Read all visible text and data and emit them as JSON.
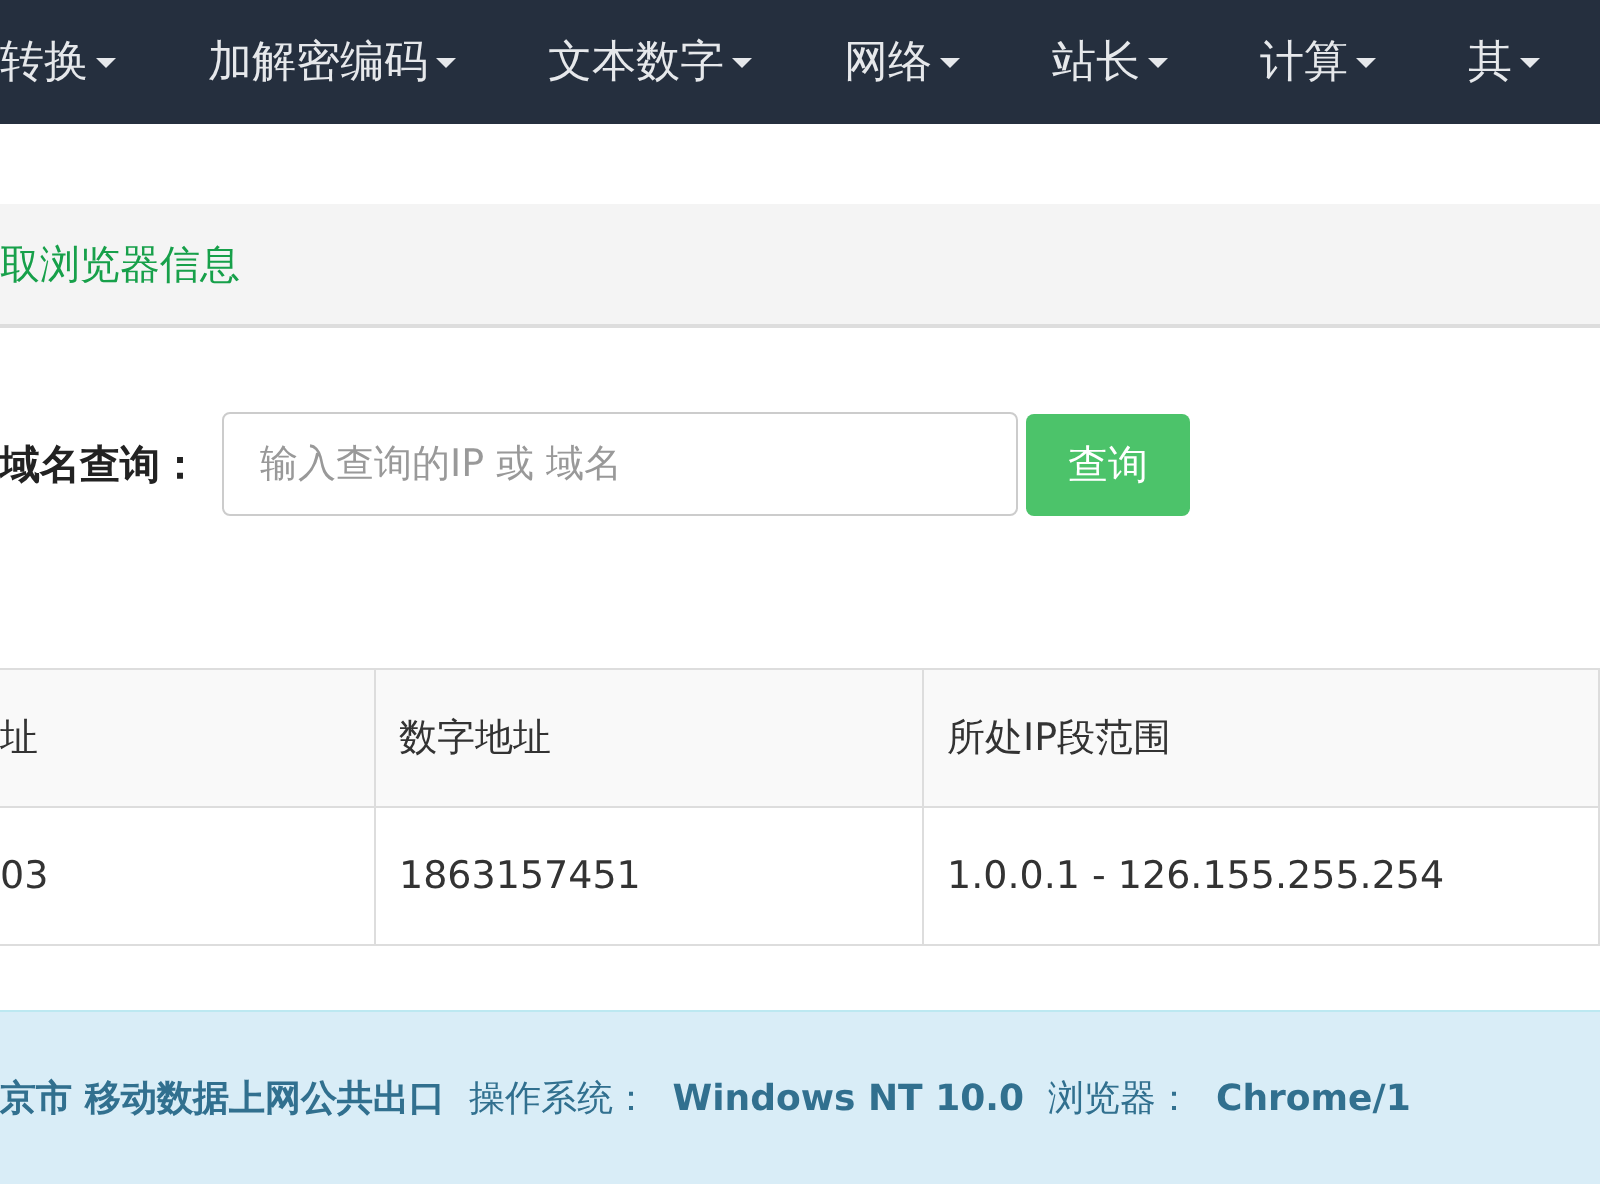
{
  "nav": {
    "items": [
      {
        "label": "转换"
      },
      {
        "label": "加解密编码"
      },
      {
        "label": "文本数字"
      },
      {
        "label": "网络"
      },
      {
        "label": "站长"
      },
      {
        "label": "计算"
      },
      {
        "label": "其"
      }
    ]
  },
  "breadcrumb": {
    "text": "取浏览器信息"
  },
  "search": {
    "label": "域名查询：",
    "placeholder": "输入查询的IP 或 域名",
    "button": "查询"
  },
  "table": {
    "columns": [
      "址",
      "数字地址",
      "所处IP段范围"
    ],
    "rows": [
      [
        "03",
        "1863157451",
        "1.0.0.1 - 126.155.255.254"
      ]
    ]
  },
  "info": {
    "parts": [
      {
        "text": "京市 移动数据上网公共出口",
        "bold": true
      },
      {
        "text": "操作系统：",
        "bold": false
      },
      {
        "text": "Windows NT 10.0",
        "bold": true
      },
      {
        "text": "浏览器：",
        "bold": false
      },
      {
        "text": "Chrome/1",
        "bold": true
      }
    ]
  }
}
